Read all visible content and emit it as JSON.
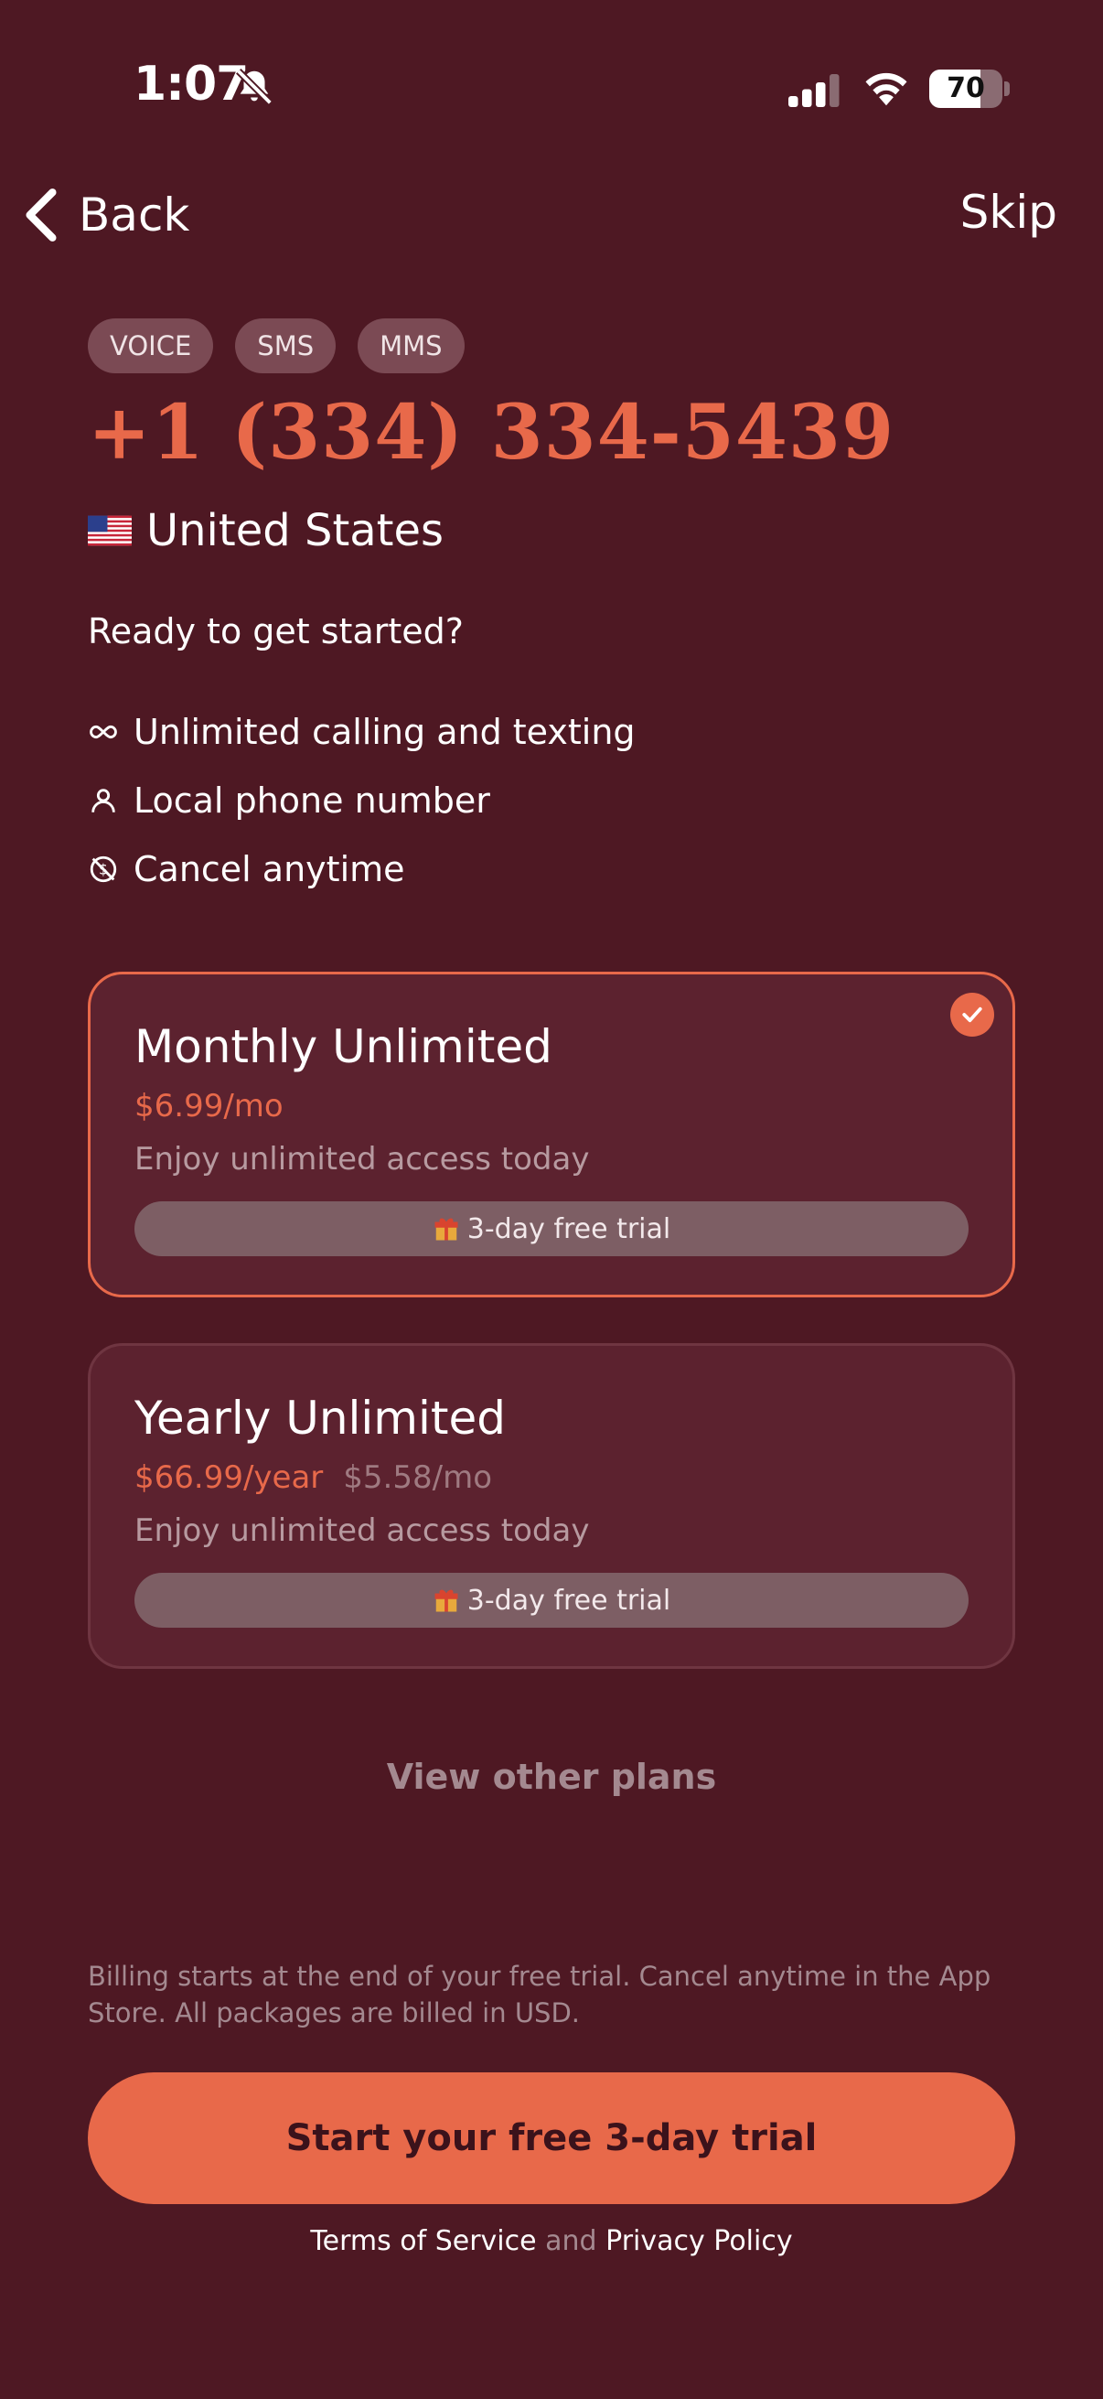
{
  "status_bar": {
    "time": "1:07",
    "battery": "70",
    "battery_fraction": 0.7
  },
  "nav": {
    "back_label": "Back",
    "skip_label": "Skip"
  },
  "capabilities": [
    "VOICE",
    "SMS",
    "MMS"
  ],
  "phone_number": "+1 (334) 334-5439",
  "country": "United States",
  "prompt": "Ready to get started?",
  "features": [
    {
      "icon": "infinity-icon",
      "label": "Unlimited calling and texting"
    },
    {
      "icon": "person-icon",
      "label": "Local phone number"
    },
    {
      "icon": "cancel-subscription-icon",
      "label": "Cancel anytime"
    }
  ],
  "plans": [
    {
      "title": "Monthly Unlimited",
      "price": "$6.99/mo",
      "per_month": "",
      "description": "Enjoy unlimited access today",
      "trial": "3-day free trial",
      "selected": true
    },
    {
      "title": "Yearly Unlimited",
      "price": "$66.99/year",
      "per_month": "$5.58/mo",
      "description": "Enjoy unlimited access today",
      "trial": "3-day free trial",
      "selected": false
    }
  ],
  "view_other_plans": "View other plans",
  "billing_note": "Billing starts at the end of your free trial. Cancel anytime in the App Store. All packages are billed in USD.",
  "cta_label": "Start your free 3-day trial",
  "legal": {
    "terms": "Terms of Service",
    "and": "and",
    "privacy": "Privacy Policy"
  },
  "colors": {
    "background": "#4e1823",
    "accent": "#e8694a",
    "card": "#5c222f"
  }
}
